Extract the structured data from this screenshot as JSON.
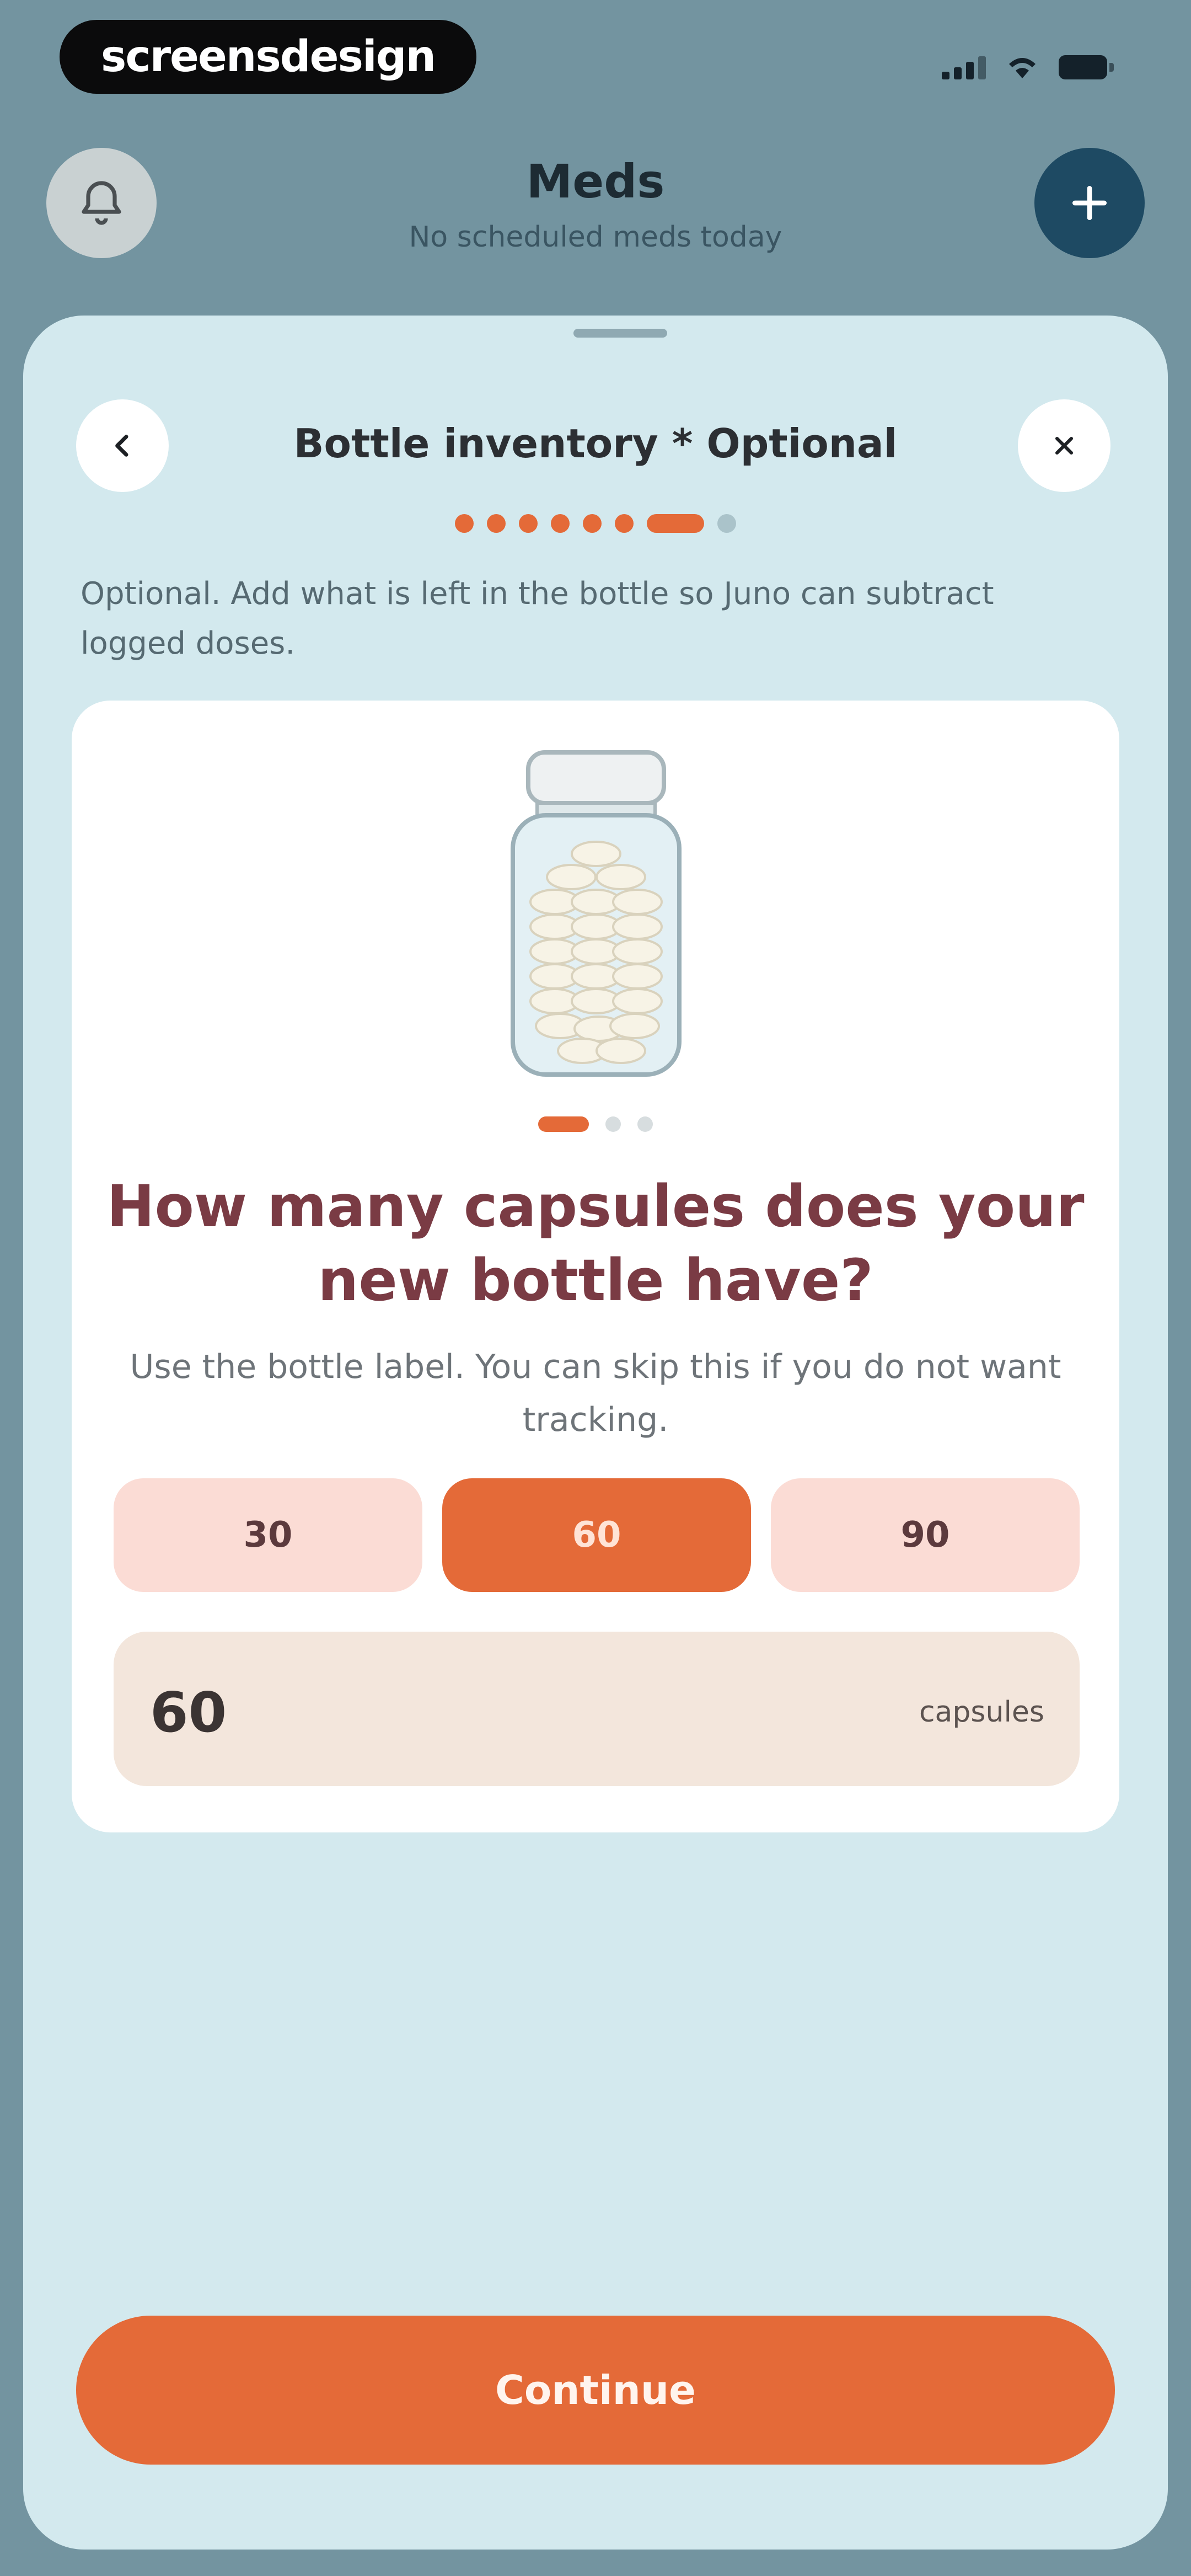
{
  "status_bar": {
    "brand": "screensdesign",
    "icons": [
      "signal-icon",
      "wifi-icon",
      "battery-icon"
    ]
  },
  "header": {
    "title": "Meds",
    "subtitle": "No scheduled meds today",
    "left_icon": "bell-icon",
    "right_icon": "plus-icon"
  },
  "sheet": {
    "title": "Bottle inventory * Optional",
    "back_icon": "chevron-left-icon",
    "close_icon": "close-icon",
    "progress": {
      "total_steps": 8,
      "current_step": 7
    },
    "intro": "Optional. Add what is left in the bottle so Juno can subtract logged doses.",
    "card": {
      "illustration": "pill-bottle-illustration",
      "pager": {
        "total": 3,
        "current": 1
      },
      "question": "How many capsules does your new bottle have?",
      "hint": "Use the bottle label. You can skip this if you do not want tracking.",
      "options": [
        "30",
        "60",
        "90"
      ],
      "selected_option": "60",
      "quantity": {
        "value": "60",
        "unit": "capsules"
      }
    },
    "continue_label": "Continue"
  },
  "colors": {
    "background": "#7394a0",
    "sheet": "#d3e9ee",
    "accent": "#e46a38",
    "header_button": "#1e4a63",
    "question_text": "#7a3b44",
    "chip": "#fbdcd5",
    "input_field": "#f3e6dc"
  }
}
